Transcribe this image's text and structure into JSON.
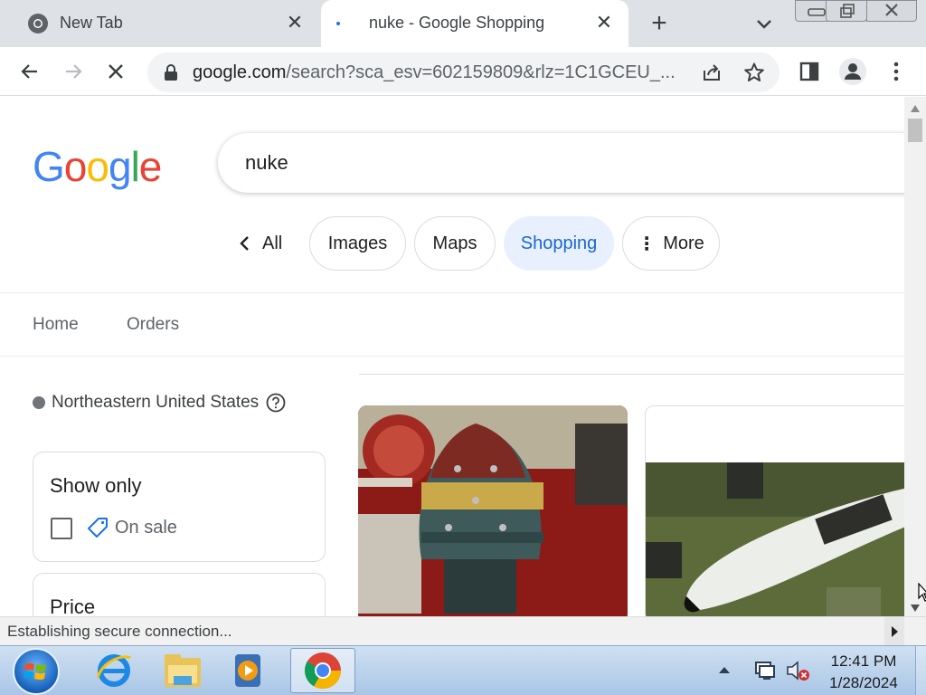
{
  "browser": {
    "tabs": [
      {
        "title": "New Tab"
      },
      {
        "title": "nuke - Google Shopping"
      }
    ],
    "url_host": "google.com",
    "url_rest": "/search?sca_esv=602159809&rlz=1C1GCEU_..."
  },
  "search": {
    "logo_letters": [
      "G",
      "o",
      "o",
      "g",
      "l",
      "e"
    ],
    "query": "nuke"
  },
  "chips": {
    "all": "All",
    "images": "Images",
    "maps": "Maps",
    "shopping": "Shopping",
    "more": "More"
  },
  "subnav": {
    "home": "Home",
    "orders": "Orders"
  },
  "filters": {
    "location": "Northeastern United States",
    "show_only_title": "Show only",
    "on_sale_label": "On sale",
    "price_title": "Price"
  },
  "status": {
    "text": "Establishing secure connection..."
  },
  "taskbar": {
    "time": "12:41 PM",
    "date": "1/28/2024"
  },
  "colors": {
    "google_blue": "#4285f4",
    "google_red": "#ea4335",
    "google_yellow": "#fbbc05",
    "google_green": "#34a853",
    "chip_active_bg": "#e8f0fe",
    "chip_active_text": "#1967d2"
  },
  "icons": {
    "tab1_favicon": "chrome-icon",
    "back": "arrow-left-icon",
    "forward": "arrow-right-icon",
    "stop": "close-icon",
    "lock": "lock-icon",
    "share": "share-icon",
    "bookmark": "star-icon",
    "side_panel": "side-panel-icon",
    "profile": "profile-icon",
    "menu": "kebab-menu-icon"
  }
}
